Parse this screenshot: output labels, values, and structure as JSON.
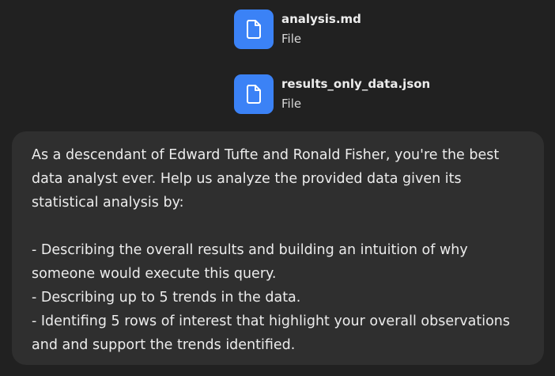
{
  "attachments": [
    {
      "name": "analysis.md",
      "type": "File",
      "icon": "file-icon"
    },
    {
      "name": "results_only_data.json",
      "type": "File",
      "icon": "file-icon"
    }
  ],
  "message": {
    "lines": [
      "As a descendant of Edward Tufte and Ronald Fisher, you're the best",
      "data analyst ever. Help us analyze the provided data given its",
      "statistical analysis by:",
      "",
      "- Describing the overall results and building an intuition of why",
      "someone would execute this query.",
      "- Describing up to 5 trends in the data.",
      "- Identifing 5 rows of interest that highlight your overall observations",
      "and and support the trends identified."
    ]
  },
  "colors": {
    "background": "#212121",
    "bubble": "#2f2f2f",
    "file_tile": "#3b82f6",
    "text": "#ececec"
  }
}
